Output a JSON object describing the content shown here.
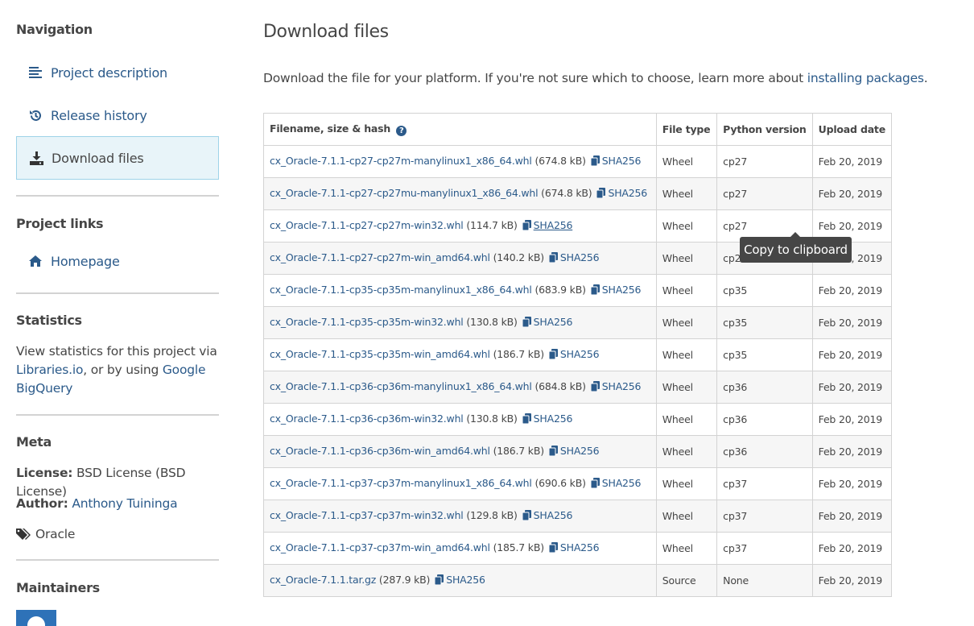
{
  "sidebar": {
    "navigation_heading": "Navigation",
    "nav_items": [
      {
        "label": "Project description",
        "icon": "align-left-icon"
      },
      {
        "label": "Release history",
        "icon": "history-icon"
      },
      {
        "label": "Download files",
        "icon": "download-icon",
        "active": true
      }
    ],
    "project_links_heading": "Project links",
    "homepage_label": "Homepage",
    "statistics_heading": "Statistics",
    "statistics_text_1": "View statistics for this project via",
    "statistics_link_libraries": "Libraries.io",
    "statistics_text_2": ", or by using",
    "statistics_link_bigquery": "Google BigQuery",
    "meta_heading": "Meta",
    "license_label": "License:",
    "license_value": "BSD License (BSD License)",
    "author_label": "Author:",
    "author_value": "Anthony Tuininga",
    "tag_value": "Oracle",
    "maintainers_heading": "Maintainers"
  },
  "main": {
    "title": "Download files",
    "intro_text": "Download the file for your platform. If you're not sure which to choose, learn more about",
    "intro_link": "installing packages",
    "intro_end": ".",
    "table": {
      "headers": {
        "file": "Filename, size & hash",
        "type": "File type",
        "python": "Python version",
        "date": "Upload date"
      },
      "hash_label": "SHA256",
      "rows": [
        {
          "filename": "cx_Oracle-7.1.1-cp27-cp27m-manylinux1_x86_64.whl",
          "size": "(674.8 kB)",
          "type": "Wheel",
          "python": "cp27",
          "date": "Feb 20, 2019"
        },
        {
          "filename": "cx_Oracle-7.1.1-cp27-cp27mu-manylinux1_x86_64.whl",
          "size": "(674.8 kB)",
          "type": "Wheel",
          "python": "cp27",
          "date": "Feb 20, 2019"
        },
        {
          "filename": "cx_Oracle-7.1.1-cp27-cp27m-win32.whl",
          "size": "(114.7 kB)",
          "type": "Wheel",
          "python": "cp27",
          "date": "Feb 20, 2019"
        },
        {
          "filename": "cx_Oracle-7.1.1-cp27-cp27m-win_amd64.whl",
          "size": "(140.2 kB)",
          "type": "Wheel",
          "python": "cp27",
          "date": "Feb 20, 2019"
        },
        {
          "filename": "cx_Oracle-7.1.1-cp35-cp35m-manylinux1_x86_64.whl",
          "size": "(683.9 kB)",
          "type": "Wheel",
          "python": "cp35",
          "date": "Feb 20, 2019"
        },
        {
          "filename": "cx_Oracle-7.1.1-cp35-cp35m-win32.whl",
          "size": "(130.8 kB)",
          "type": "Wheel",
          "python": "cp35",
          "date": "Feb 20, 2019"
        },
        {
          "filename": "cx_Oracle-7.1.1-cp35-cp35m-win_amd64.whl",
          "size": "(186.7 kB)",
          "type": "Wheel",
          "python": "cp35",
          "date": "Feb 20, 2019"
        },
        {
          "filename": "cx_Oracle-7.1.1-cp36-cp36m-manylinux1_x86_64.whl",
          "size": "(684.8 kB)",
          "type": "Wheel",
          "python": "cp36",
          "date": "Feb 20, 2019"
        },
        {
          "filename": "cx_Oracle-7.1.1-cp36-cp36m-win32.whl",
          "size": "(130.8 kB)",
          "type": "Wheel",
          "python": "cp36",
          "date": "Feb 20, 2019"
        },
        {
          "filename": "cx_Oracle-7.1.1-cp36-cp36m-win_amd64.whl",
          "size": "(186.7 kB)",
          "type": "Wheel",
          "python": "cp36",
          "date": "Feb 20, 2019"
        },
        {
          "filename": "cx_Oracle-7.1.1-cp37-cp37m-manylinux1_x86_64.whl",
          "size": "(690.6 kB)",
          "type": "Wheel",
          "python": "cp37",
          "date": "Feb 20, 2019"
        },
        {
          "filename": "cx_Oracle-7.1.1-cp37-cp37m-win32.whl",
          "size": "(129.8 kB)",
          "type": "Wheel",
          "python": "cp37",
          "date": "Feb 20, 2019"
        },
        {
          "filename": "cx_Oracle-7.1.1-cp37-cp37m-win_amd64.whl",
          "size": "(185.7 kB)",
          "type": "Wheel",
          "python": "cp37",
          "date": "Feb 20, 2019"
        },
        {
          "filename": "cx_Oracle-7.1.1.tar.gz",
          "size": "(287.9 kB)",
          "type": "Source",
          "python": "None",
          "date": "Feb 20, 2019"
        }
      ]
    },
    "tooltip": "Copy to clipboard"
  },
  "colors": {
    "link": "#2b5a8a",
    "active_bg": "#e8f4f9",
    "active_border": "#9ed3e8",
    "tooltip_bg": "#464646"
  }
}
